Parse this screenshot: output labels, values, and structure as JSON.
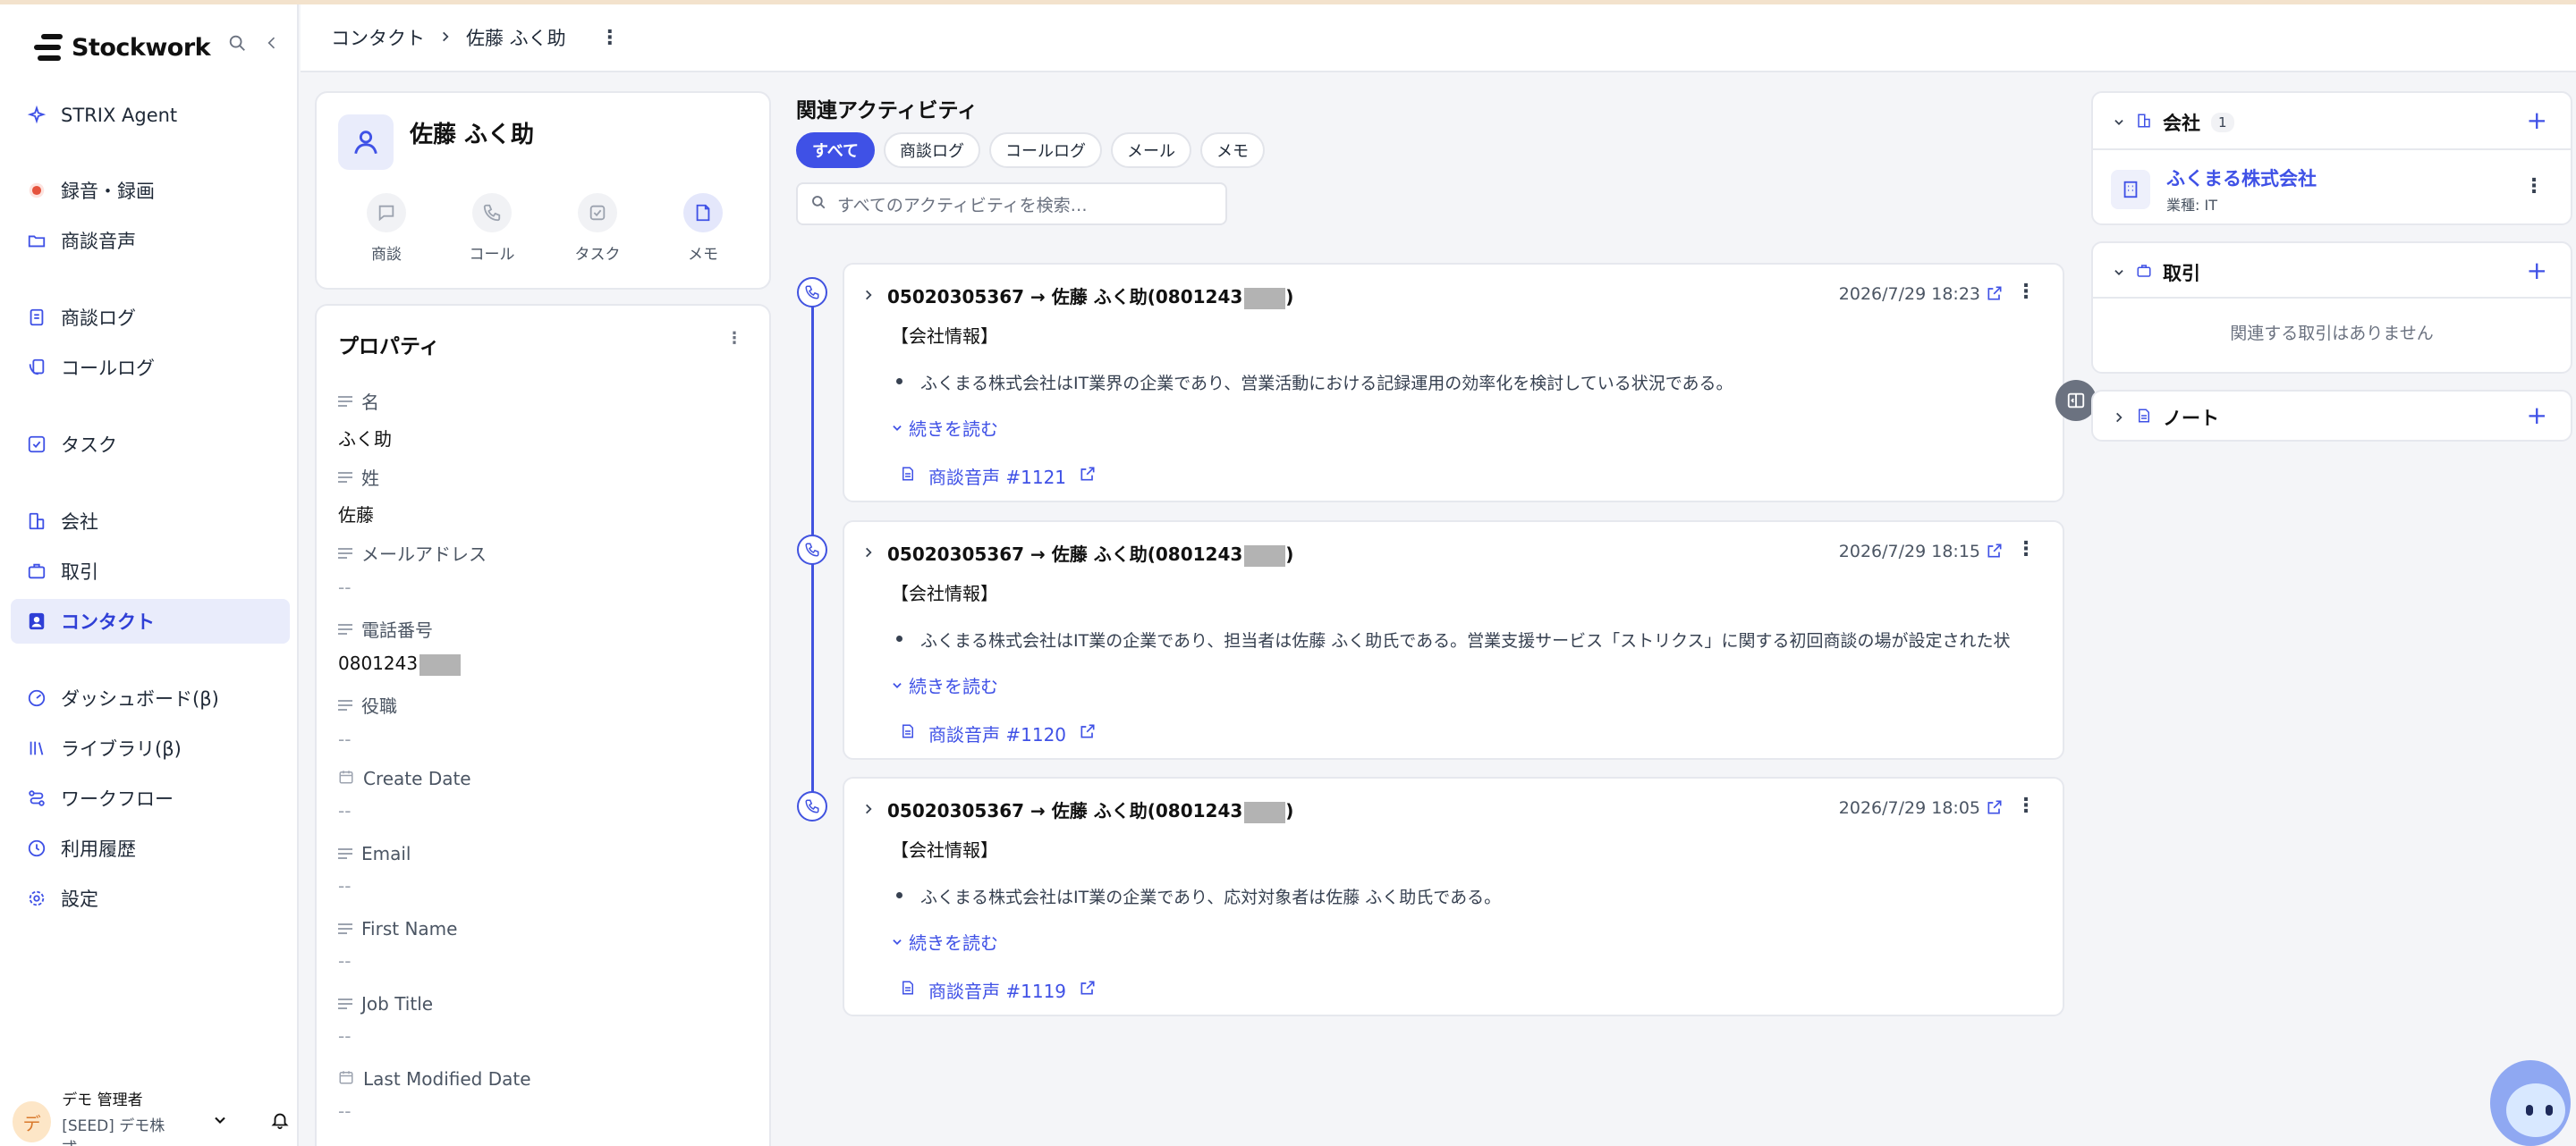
{
  "app": {
    "name": "Stockwork"
  },
  "sidebar": {
    "items": [
      {
        "label": "STRIX Agent",
        "icon": "sparkle-icon"
      },
      {
        "label": "録音・録画",
        "icon": "record-icon"
      },
      {
        "label": "商談音声",
        "icon": "folder-icon"
      },
      {
        "label": "商談ログ",
        "icon": "document-icon"
      },
      {
        "label": "コールログ",
        "icon": "call-log-icon"
      },
      {
        "label": "タスク",
        "icon": "checkbox-icon"
      },
      {
        "label": "会社",
        "icon": "building-icon"
      },
      {
        "label": "取引",
        "icon": "briefcase-icon"
      },
      {
        "label": "コンタクト",
        "icon": "contact-icon",
        "active": true
      },
      {
        "label": "ダッシュボード(β)",
        "icon": "dashboard-icon"
      },
      {
        "label": "ライブラリ(β)",
        "icon": "library-icon"
      },
      {
        "label": "ワークフロー",
        "icon": "workflow-icon"
      },
      {
        "label": "利用履歴",
        "icon": "history-icon"
      },
      {
        "label": "設定",
        "icon": "gear-icon"
      }
    ],
    "user": {
      "avatar": "デ",
      "name": "デモ 管理者",
      "org": "[SEED] デモ株式…"
    }
  },
  "header": {
    "breadcrumb": [
      "コンタクト",
      "佐藤 ふく助"
    ]
  },
  "profile": {
    "name": "佐藤 ふく助",
    "actions": [
      {
        "label": "商談",
        "icon": "chat-icon"
      },
      {
        "label": "コール",
        "icon": "phone-icon"
      },
      {
        "label": "タスク",
        "icon": "task-icon"
      },
      {
        "label": "メモ",
        "icon": "memo-icon"
      }
    ]
  },
  "properties": {
    "title": "プロパティ",
    "items": [
      {
        "label": "名",
        "value": "ふく助"
      },
      {
        "label": "姓",
        "value": "佐藤"
      },
      {
        "label": "メールアドレス",
        "value": "--"
      },
      {
        "label": "電話番号",
        "value": "0801243"
      },
      {
        "label": "役職",
        "value": "--"
      },
      {
        "label": "Create Date",
        "value": "--"
      },
      {
        "label": "Email",
        "value": "--"
      },
      {
        "label": "First Name",
        "value": "--"
      },
      {
        "label": "Job Title",
        "value": "--"
      },
      {
        "label": "Last Modified Date",
        "value": "--"
      }
    ]
  },
  "activity": {
    "title": "関連アクティビティ",
    "filters": [
      "すべて",
      "商談ログ",
      "コールログ",
      "メール",
      "メモ"
    ],
    "active_filter": "すべて",
    "search_placeholder": "すべてのアクティビティを検索…",
    "items": [
      {
        "title_prefix": "05020305367 → 佐藤 ふく助(0801243",
        "title_suffix": ")",
        "date": "2026/7/29 18:23",
        "section": "【会社情報】",
        "bullet": "ふくまる株式会社はIT業界の企業であり、営業活動における記録運用の効率化を検討している状況である。",
        "more": "続きを読む",
        "link": "商談音声 #1121"
      },
      {
        "title_prefix": "05020305367 → 佐藤 ふく助(0801243",
        "title_suffix": ")",
        "date": "2026/7/29 18:15",
        "section": "【会社情報】",
        "bullet": "ふくまる株式会社はIT業の企業であり、担当者は佐藤 ふく助氏である。営業支援サービス「ストリクス」に関する初回商談の場が設定された状",
        "more": "続きを読む",
        "link": "商談音声 #1120"
      },
      {
        "title_prefix": "05020305367 → 佐藤 ふく助(0801243",
        "title_suffix": ")",
        "date": "2026/7/29 18:05",
        "section": "【会社情報】",
        "bullet": "ふくまる株式会社はIT業の企業であり、応対対象者は佐藤 ふく助氏である。",
        "more": "続きを読む",
        "link": "商談音声 #1119"
      }
    ]
  },
  "right": {
    "company": {
      "title": "会社",
      "count": "1",
      "name": "ふくまる株式会社",
      "industry": "業種: IT"
    },
    "deals": {
      "title": "取引",
      "empty": "関連する取引はありません"
    },
    "notes": {
      "title": "ノート"
    }
  },
  "colors": {
    "accent": "#3f51e6",
    "accent_bg": "#e9ecfb",
    "record": "#e5533d"
  }
}
